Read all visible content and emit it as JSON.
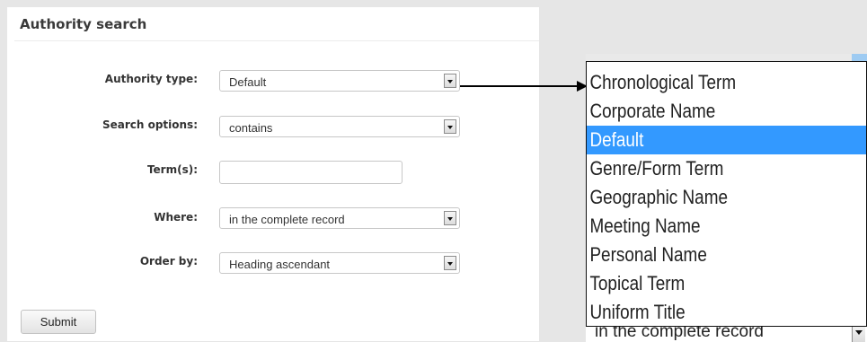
{
  "panel": {
    "title": "Authority search"
  },
  "form": {
    "authority_type": {
      "label": "Authority type:",
      "value": "Default"
    },
    "search_options": {
      "label": "Search options:",
      "value": "contains"
    },
    "terms": {
      "label": "Term(s):",
      "value": ""
    },
    "where": {
      "label": "Where:",
      "value": "in the complete record"
    },
    "order_by": {
      "label": "Order by:",
      "value": "Heading ascendant"
    },
    "submit_label": "Submit"
  },
  "dropdown": {
    "options": [
      "Chronological Term",
      "Corporate Name",
      "Default",
      "Genre/Form Term",
      "Geographic Name",
      "Meeting Name",
      "Personal Name",
      "Topical Term",
      "Uniform Title"
    ],
    "selected": "Default",
    "behind_value": "in the complete record"
  },
  "colors": {
    "highlight": "#3399ff",
    "background": "#e6e6e6"
  }
}
